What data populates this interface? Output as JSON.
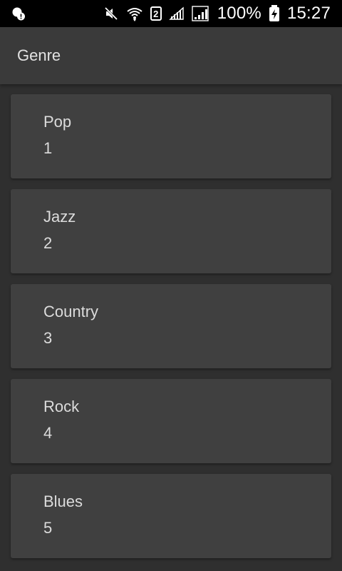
{
  "status_bar": {
    "battery_percent": "100%",
    "time": "15:27",
    "sim_number": "2"
  },
  "header": {
    "title": "Genre"
  },
  "genres": [
    {
      "name": "Pop",
      "count": "1"
    },
    {
      "name": "Jazz",
      "count": "2"
    },
    {
      "name": "Country",
      "count": "3"
    },
    {
      "name": "Rock",
      "count": "4"
    },
    {
      "name": "Blues",
      "count": "5"
    }
  ],
  "icons": {
    "status_left": "notification-alert-icon",
    "mute": "muted-speaker-icon",
    "wifi": "wifi-icon",
    "signal_1": "signal-icon",
    "signal_2": "signal-icon",
    "battery": "battery-charging-icon"
  }
}
